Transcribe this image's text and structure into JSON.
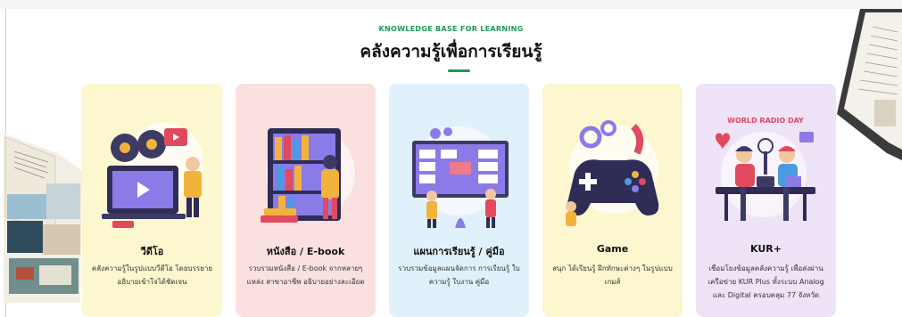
{
  "header": {
    "eyebrow": "KNOWLEDGE BASE FOR LEARNING",
    "title": "คลังความรู้เพื่อการเรียนรู้"
  },
  "colors": {
    "accent": "#1c9a55",
    "card_video": "#fdf7cf",
    "card_ebook": "#fbe0e0",
    "card_plan": "#e1f1fb",
    "card_game": "#fdf7cf",
    "card_kur": "#efe3f8"
  },
  "cards": [
    {
      "title": "วีดีโอ",
      "lines": [
        "คลังความรู้ในรูปแบบวีดีโอ โดยบรรยาย",
        "อธิบายเข้าใจได้ชัดเจน"
      ],
      "icon": "video-illustration-icon"
    },
    {
      "title": "หนังสือ / E-book",
      "lines": [
        "รวบรวมหนังสือ / E-book จากหลายๆ",
        "แหล่ง สาขาอาชีพ อธิบายอย่างละเอียด"
      ],
      "icon": "books-illustration-icon"
    },
    {
      "title": "แผนการเรียนรู้ / คู่มือ",
      "lines": [
        "รวบรวมข้อมูลแผนจัดการ การเรียนรู้ ใบ",
        "ความรู้ ใบงาน คู่มือ"
      ],
      "icon": "planning-board-illustration-icon"
    },
    {
      "title": "Game",
      "lines": [
        "สนุก ได้เรียนรู้ ฝึกทักษะต่างๆ ในรูปแบบ",
        "เกมส์"
      ],
      "icon": "gamepad-illustration-icon"
    },
    {
      "title": "KUR+",
      "lines": [
        "เชื่อมโยงข้อมูลคลังความรู้ เพื่อส่งผ่าน",
        "เครือข่าย KUR Plus ทั้งระบบ Analog",
        "และ Digital ครอบคลุม 77 จังหวัด"
      ],
      "icon": "radio-studio-illustration-icon",
      "art_text": "WORLD RADIO DAY"
    }
  ]
}
